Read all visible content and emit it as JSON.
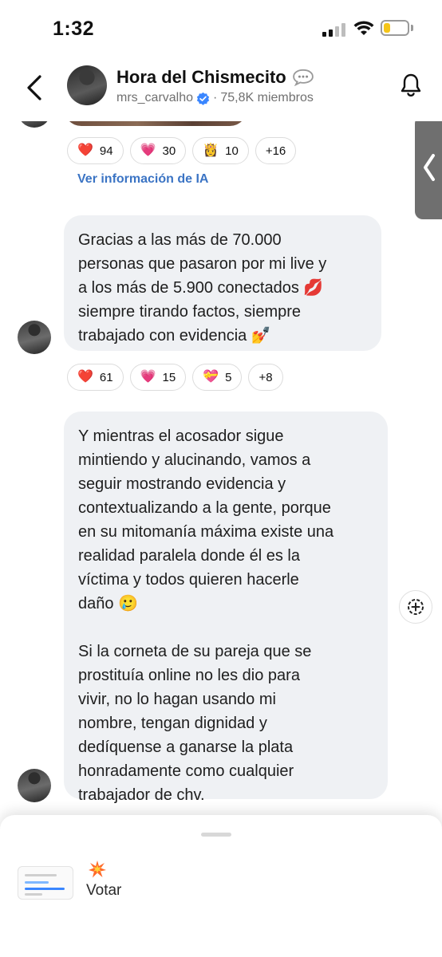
{
  "status_bar": {
    "time": "1:32",
    "battery_level": 0.3,
    "battery_color": "#f5c518"
  },
  "header": {
    "title": "Hora del Chismecito",
    "title_icon": "speech-bubble-icon",
    "username": "mrs_carvalho",
    "members": "75,8K miembros",
    "separator": "·"
  },
  "message1": {
    "reactions": [
      {
        "emoji": "❤️",
        "count": "94"
      },
      {
        "emoji": "💗",
        "count": "30"
      },
      {
        "emoji": "👸",
        "count": "10"
      }
    ],
    "more": "+16",
    "ai_link": "Ver información de IA"
  },
  "message2": {
    "text": "Gracias a las más de 70.000\npersonas que pasaron por mi live y\na los más de 5.900 conectados 💋\nsiempre tirando factos, siempre\ntrabajado con evidencia 💅",
    "reactions": [
      {
        "emoji": "❤️",
        "count": "61"
      },
      {
        "emoji": "💗",
        "count": "15"
      },
      {
        "emoji": "💝",
        "count": "5"
      }
    ],
    "more": "+8"
  },
  "message3": {
    "paragraph1": "Y mientras el acosador sigue\nmintiendo y alucinando, vamos a\nseguir mostrando evidencia y\ncontextualizando a la gente, porque\nen su mitomanía máxima existe una\nrealidad paralela donde él es la\nvíctima y todos quieren hacerle\ndaño 🥲",
    "paragraph2": "Si la corneta de su pareja que se\nprostituía online no les dio para\nvivir, no lo hagan usando mi\nnombre, tengan dignidad y\ndedíquense a ganarse la plata\nhonradamente como cualquier\ntrabajador de chv."
  },
  "bottom_sheet": {
    "vote_label": "Votar",
    "vote_icon": "boom-icon"
  },
  "colors": {
    "link": "#3b74c4",
    "bubble": "#eff1f4",
    "verified": "#3a86ff"
  }
}
